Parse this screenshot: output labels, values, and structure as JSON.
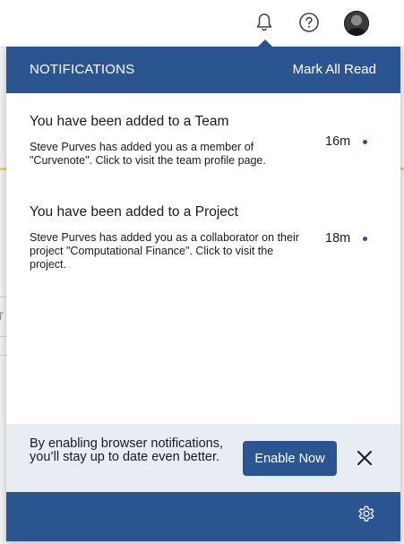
{
  "header": {
    "icons": [
      "bell-icon",
      "help-circle-icon"
    ],
    "avatar": "user-avatar"
  },
  "panel": {
    "title": "NOTIFICATIONS",
    "mark_all_read": "Mark All Read",
    "notifications": [
      {
        "title": "You have been added to a Team",
        "body": "Steve Purves has added you as a member of \"Curvenote\". Click to visit the team profile page.",
        "time": "16m",
        "unread": true
      },
      {
        "title": "You have been added to a Project",
        "body": "Steve Purves has added you as a collaborator on their project \"Computational Finance\". Click to visit the project.",
        "time": "18m",
        "unread": true
      }
    ],
    "enable_bar": {
      "text": "By enabling browser notifications, you’ll stay up to date even better.",
      "button": "Enable Now",
      "close_icon": "close-icon"
    },
    "footer": {
      "icon": "gear-icon"
    }
  },
  "background": {
    "fragment_text": "T"
  },
  "colors": {
    "brand": "#2b5590",
    "enable_bar_bg": "#e8edf4",
    "background_accent": "#f3d24a"
  }
}
